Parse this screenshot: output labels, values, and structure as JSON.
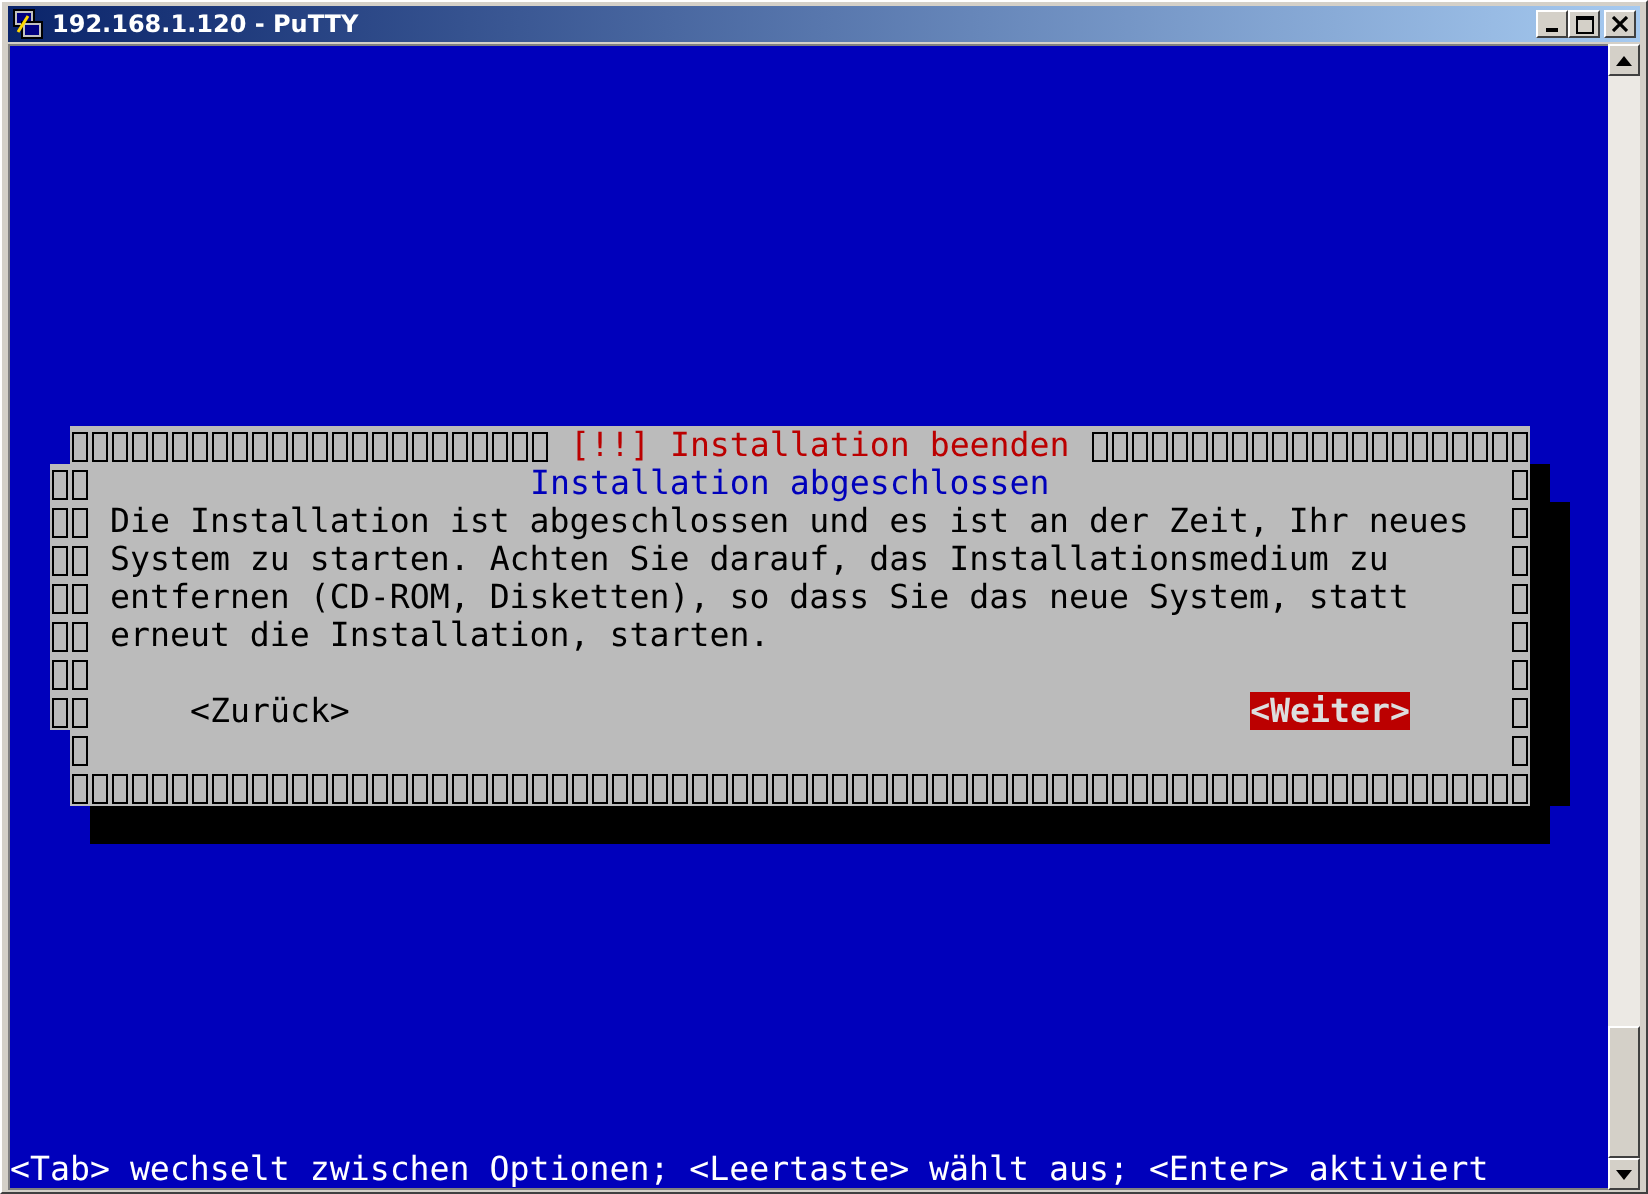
{
  "window": {
    "title": "192.168.1.120 - PuTTY"
  },
  "dialog": {
    "title": "[!!] Installation beenden",
    "heading": "Installation abgeschlossen",
    "message": "Die Installation ist abgeschlossen und es ist an der Zeit, Ihr neues System zu starten. Achten Sie darauf, das Installationsmedium zu entfernen (CD-ROM, Disketten), so dass Sie das neue System, statt erneut die Installation, starten.",
    "buttons": [
      {
        "label": "<Zurück>",
        "selected": false
      },
      {
        "label": "<Weiter>",
        "selected": true
      }
    ]
  },
  "status_line": "<Tab> wechselt zwischen Optionen; <Leertaste> wählt aus; <Enter> aktiviert"
}
